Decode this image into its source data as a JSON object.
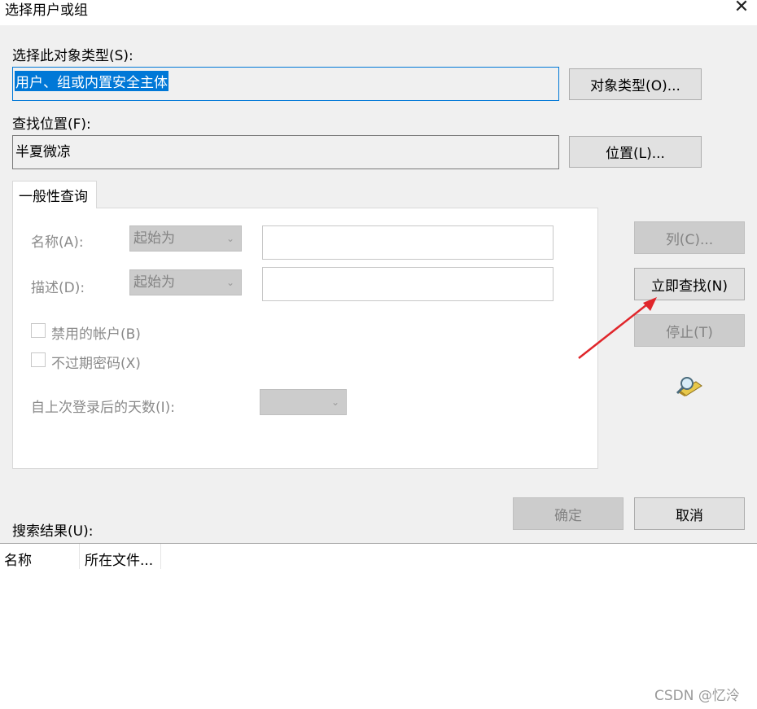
{
  "window": {
    "title": "选择用户或组",
    "close_glyph": "✕"
  },
  "object_type": {
    "label": "选择此对象类型(S):",
    "value": "用户、组或内置安全主体",
    "button": "对象类型(O)..."
  },
  "location": {
    "label": "查找位置(F):",
    "value": "半夏微凉",
    "button": "位置(L)..."
  },
  "query_tab": {
    "label": "一般性查询"
  },
  "query": {
    "name_label": "名称(A):",
    "name_mode": "起始为",
    "desc_label": "描述(D):",
    "desc_mode": "起始为",
    "disabled_accounts_label": "禁用的帐户(B)",
    "non_expiring_pw_label": "不过期密码(X)",
    "days_since_login_label": "自上次登录后的天数(I):"
  },
  "side_buttons": {
    "columns": "列(C)...",
    "find_now": "立即查找(N)",
    "stop": "停止(T)"
  },
  "dialog_buttons": {
    "ok": "确定",
    "cancel": "取消"
  },
  "results": {
    "label": "搜索结果(U):",
    "columns": [
      "名称",
      "所在文件..."
    ]
  },
  "watermark": "CSDN @忆泠",
  "colors": {
    "accent": "#0078d7",
    "annotation_arrow": "#e0262b"
  },
  "icons": [
    "close-icon",
    "search-animation-icon",
    "annotation-arrow"
  ]
}
